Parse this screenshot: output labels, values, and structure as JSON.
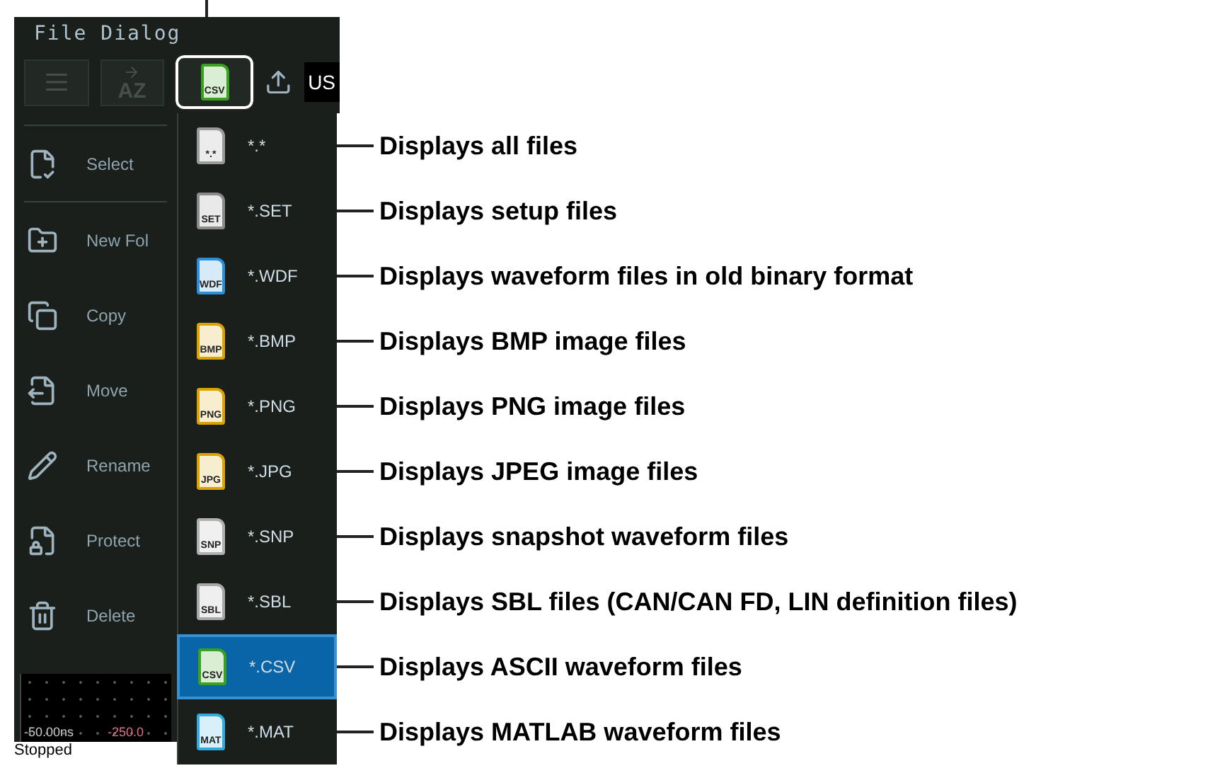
{
  "window": {
    "title": "File Dialog"
  },
  "toolbar": {
    "sort_label": "AZ",
    "filter_button": {
      "icon_text": "CSV",
      "color": "#3aa020"
    },
    "drive": "US"
  },
  "menu": [
    {
      "kind": "select",
      "label": "Select"
    },
    {
      "kind": "new-folder",
      "label": "New Fol"
    },
    {
      "kind": "copy",
      "label": "Copy"
    },
    {
      "kind": "move",
      "label": "Move"
    },
    {
      "kind": "rename",
      "label": "Rename"
    },
    {
      "kind": "protect",
      "label": "Protect"
    },
    {
      "kind": "delete",
      "label": "Delete"
    }
  ],
  "filters": [
    {
      "label": "*.*",
      "icon_text": "*.*",
      "color": "#9a9a9a",
      "selected": false,
      "description": "Displays all files"
    },
    {
      "label": "*.SET",
      "icon_text": "SET",
      "color": "#8a8a8a",
      "selected": false,
      "description": "Displays setup files"
    },
    {
      "label": "*.WDF",
      "icon_text": "WDF",
      "color": "#2a8fd6",
      "selected": false,
      "description": "Displays waveform files in old binary format"
    },
    {
      "label": "*.BMP",
      "icon_text": "BMP",
      "color": "#d9a400",
      "selected": false,
      "description": "Displays BMP image files"
    },
    {
      "label": "*.PNG",
      "icon_text": "PNG",
      "color": "#d9a401",
      "selected": false,
      "description": "Displays PNG image files"
    },
    {
      "label": "*.JPG",
      "icon_text": "JPG",
      "color": "#d9a402",
      "selected": false,
      "description": "Displays JPEG image files"
    },
    {
      "label": "*.SNP",
      "icon_text": "SNP",
      "color": "#b0b0b0",
      "selected": false,
      "description": "Displays snapshot waveform files"
    },
    {
      "label": "*.SBL",
      "icon_text": "SBL",
      "color": "#a8a8a8",
      "selected": false,
      "description": "Displays SBL files (CAN/CAN FD, LIN definition files)"
    },
    {
      "label": "*.CSV",
      "icon_text": "CSV",
      "color": "#3aa020",
      "selected": true,
      "description": "Displays ASCII waveform files"
    },
    {
      "label": "*.MAT",
      "icon_text": "MAT",
      "color": "#33aadd",
      "selected": false,
      "description": "Displays MATLAB waveform files"
    }
  ],
  "waveform": {
    "x_labels": [
      "-50.00ns",
      "-250.0"
    ]
  },
  "status": "Stopped"
}
